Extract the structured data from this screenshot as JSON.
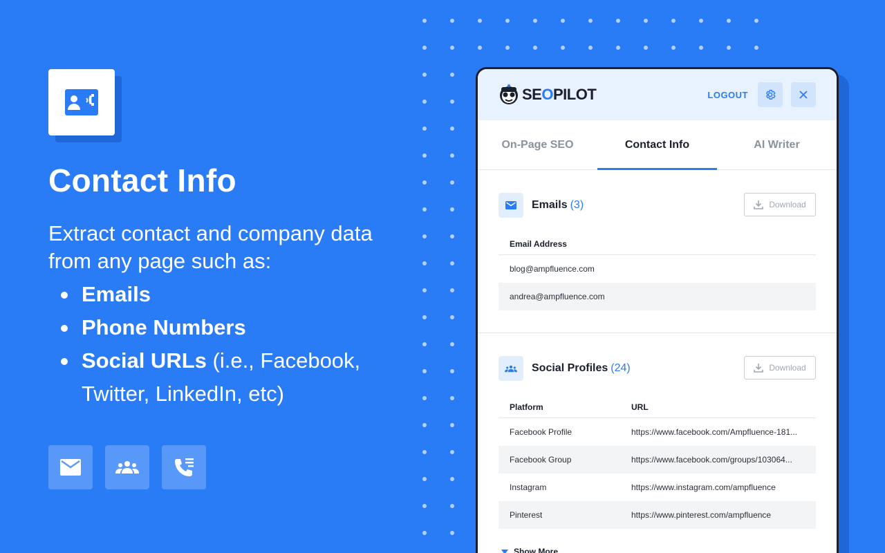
{
  "hero": {
    "title": "Contact Info",
    "description": "Extract contact and company data from any page such as:",
    "bullets": [
      {
        "bold": "Emails",
        "rest": ""
      },
      {
        "bold": "Phone Numbers",
        "rest": ""
      },
      {
        "bold": "Social URLs",
        "rest": " (i.e., Facebook,",
        "cont": "Twitter, LinkedIn, etc)"
      }
    ]
  },
  "panel": {
    "logo_part1": "SE",
    "logo_part2": "O",
    "logo_part3": "PILOT",
    "logout_label": "LOGOUT",
    "tabs": [
      {
        "label": "On-Page SEO",
        "active": false
      },
      {
        "label": "Contact Info",
        "active": true
      },
      {
        "label": "AI Writer",
        "active": false
      }
    ],
    "emails": {
      "title": "Emails",
      "count": "(3)",
      "download_label": "Download",
      "column": "Email Address",
      "rows": [
        "blog@ampfluence.com",
        "andrea@ampfluence.com"
      ]
    },
    "social": {
      "title": "Social Profiles",
      "count": "(24)",
      "download_label": "Download",
      "columns": [
        "Platform",
        "URL"
      ],
      "rows": [
        {
          "platform": "Facebook Profile",
          "url": "https://www.facebook.com/Ampfluence-181..."
        },
        {
          "platform": "Facebook Group",
          "url": "https://www.facebook.com/groups/103064..."
        },
        {
          "platform": "Instagram",
          "url": "https://www.instagram.com/ampfluence"
        },
        {
          "platform": "Pinterest",
          "url": "https://www.pinterest.com/ampfluence"
        }
      ],
      "show_more_label": "Show More"
    }
  },
  "colors": {
    "background": "#2a7bf6",
    "accent": "#2a7bf6",
    "panel_header": "#e8f1fe",
    "text_dark": "#1a1f2b"
  }
}
